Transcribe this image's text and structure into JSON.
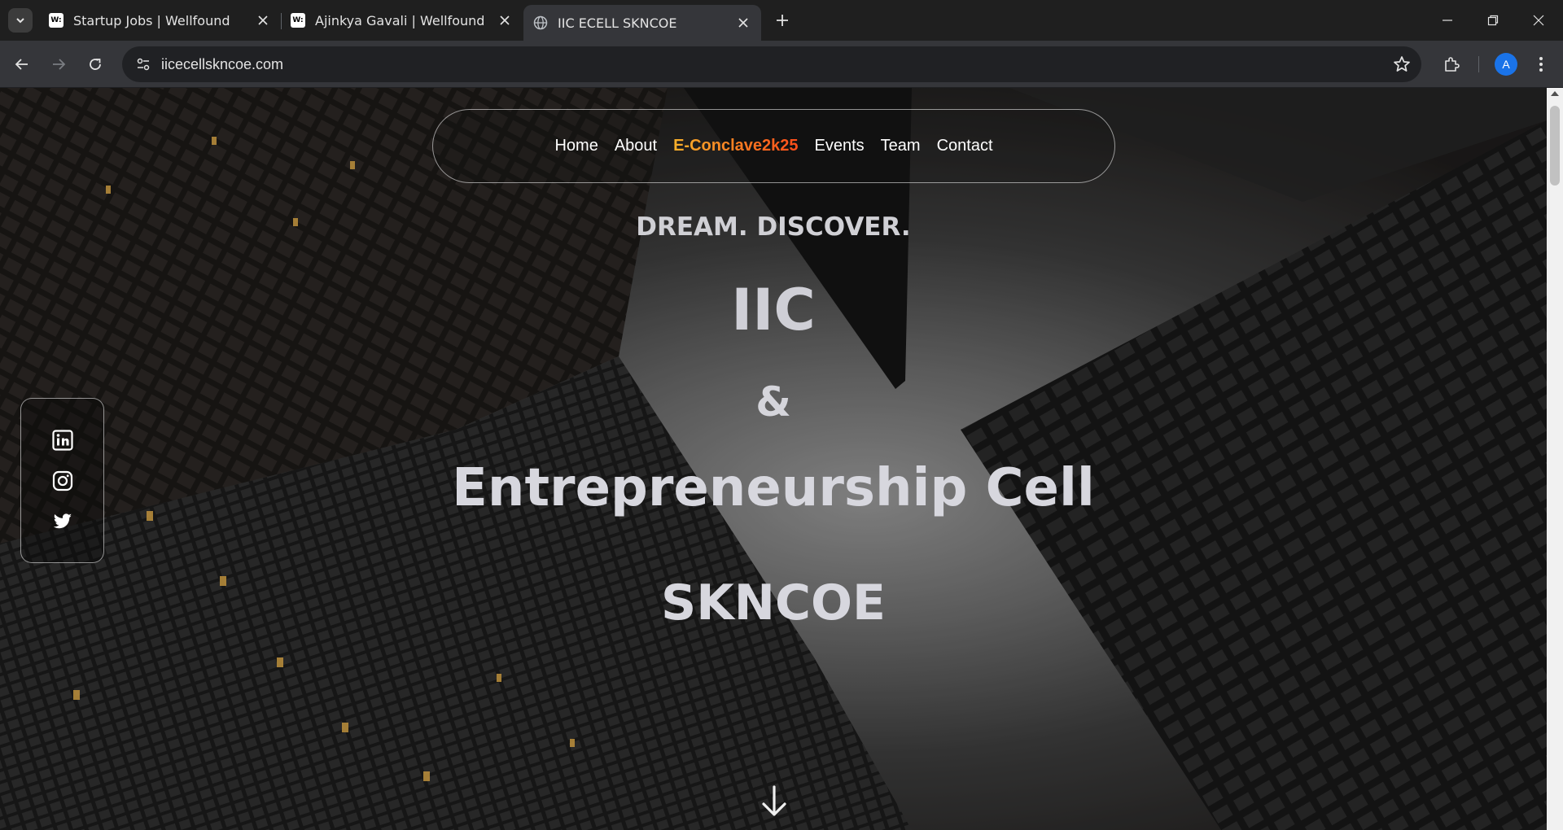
{
  "browser": {
    "tabs": [
      {
        "title": "Startup Jobs | Wellfound",
        "favicon": "W:",
        "active": false
      },
      {
        "title": "Ajinkya Gavali | Wellfound",
        "favicon": "W:",
        "active": false
      },
      {
        "title": "IIC ECELL SKNCOE",
        "favicon": "globe-icon",
        "active": true
      }
    ],
    "url": "iicecellskncoe.com",
    "profile_initial": "A",
    "accent": "#1a73e8"
  },
  "nav": {
    "items": [
      "Home",
      "About",
      "E-Conclave2k25",
      "Events",
      "Team",
      "Contact"
    ],
    "highlight_colors": [
      "#f7b02a",
      "#ff4d1a"
    ]
  },
  "hero": {
    "tagline": "DREAM. DISCOVER.",
    "line1": "IIC",
    "line2": "&",
    "line3": "Entrepreneurship Cell",
    "line4": "SKNCOE"
  },
  "social": {
    "icons": [
      "linkedin-icon",
      "instagram-icon",
      "twitter-icon"
    ]
  }
}
